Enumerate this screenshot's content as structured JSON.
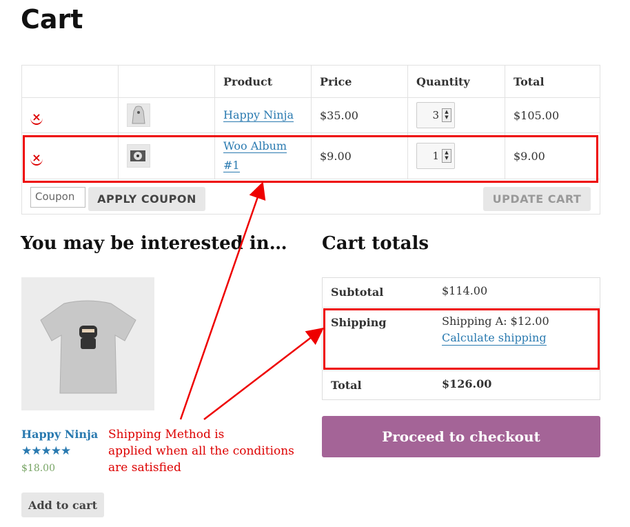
{
  "page": {
    "title": "Cart"
  },
  "cart_table": {
    "headers": {
      "remove": "",
      "thumbnail": "",
      "product": "Product",
      "price": "Price",
      "quantity": "Quantity",
      "total": "Total"
    },
    "rows": [
      {
        "remove_icon": "×",
        "product": "Happy Ninja",
        "price": "$35.00",
        "quantity": "3",
        "total": "$105.00"
      },
      {
        "remove_icon": "×",
        "product_line1": "Woo Album",
        "product_line2": "#1",
        "price": "$9.00",
        "quantity": "1",
        "total": "$9.00"
      }
    ]
  },
  "actions": {
    "coupon_value": "Coupon",
    "apply_coupon_label": "APPLY COUPON",
    "update_cart_label": "UPDATE CART"
  },
  "upsells": {
    "heading": "You may be interested in…",
    "product_name": "Happy Ninja",
    "rating_stars": "★★★★★",
    "rating_value": 5,
    "price": "$18.00",
    "add_to_cart_label": "Add to cart"
  },
  "cart_totals": {
    "heading": "Cart totals",
    "subtotal_label": "Subtotal",
    "subtotal_value": "$114.00",
    "shipping_label": "Shipping",
    "shipping_value": "Shipping A: $12.00",
    "calculate_shipping_label": "Calculate shipping",
    "total_label": "Total",
    "total_value": "$126.00",
    "checkout_label": "Proceed to checkout"
  },
  "annotation": {
    "text_line1": "Shipping Method is",
    "text_line2": "applied when all the conditions",
    "text_line3": "are satisfied",
    "color": "#dd0000"
  },
  "colors": {
    "accent": "#a46497",
    "link": "#2a7ab0",
    "price_green": "#77a464",
    "annotation_red": "#e00000"
  }
}
